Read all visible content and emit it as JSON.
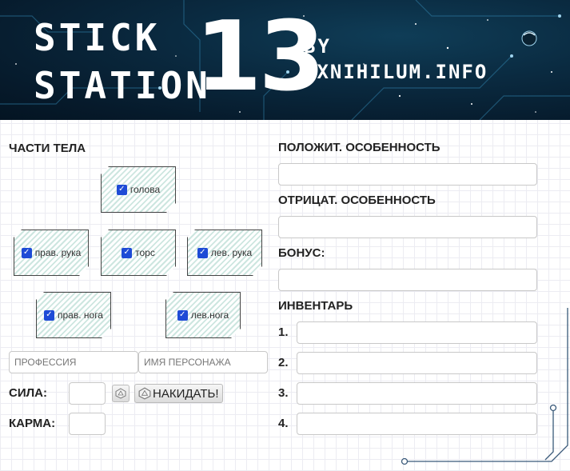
{
  "header": {
    "title_line1": "STICK",
    "title_line2": "STATION",
    "title_number": "13",
    "by": "BY",
    "site": "EXNIHILUM.INFO"
  },
  "body_parts": {
    "heading": "ЧАСТИ ТЕЛА",
    "head": {
      "label": "голова",
      "checked": true
    },
    "right_arm": {
      "label": "прав. рука",
      "checked": true
    },
    "torso": {
      "label": "торс",
      "checked": true
    },
    "left_arm": {
      "label": "лев. рука",
      "checked": true
    },
    "right_leg": {
      "label": "прав. нога",
      "checked": true
    },
    "left_leg": {
      "label": "лев.нога",
      "checked": true
    }
  },
  "character": {
    "profession_placeholder": "ПРОФЕССИЯ",
    "name_placeholder": "ИМЯ ПЕРСОНАЖА",
    "strength_label": "СИЛА:",
    "karma_label": "КАРМА:",
    "roll_label": "НАКИДАТЬ!",
    "strength_value": "",
    "karma_value": ""
  },
  "traits": {
    "positive_label": "ПОЛОЖИТ. ОСОБЕННОСТЬ",
    "negative_label": "ОТРИЦАТ. ОСОБЕННОСТЬ",
    "bonus_label": "БОНУС:",
    "positive_value": "",
    "negative_value": "",
    "bonus_value": ""
  },
  "inventory": {
    "heading": "ИНВЕНТАРЬ",
    "items": [
      {
        "num": "1.",
        "value": ""
      },
      {
        "num": "2.",
        "value": ""
      },
      {
        "num": "3.",
        "value": ""
      },
      {
        "num": "4.",
        "value": ""
      }
    ]
  },
  "colors": {
    "header_bg": "#061a2b",
    "checkbox": "#1e4bd6",
    "hatch": "#cde6e0"
  },
  "icons": {
    "dice": "d20-dice-icon",
    "check": "checkmark-icon"
  }
}
